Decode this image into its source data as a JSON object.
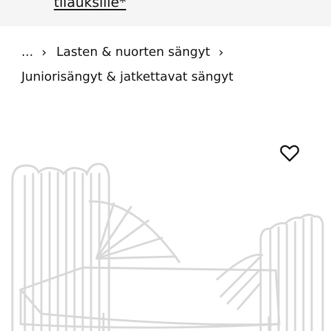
{
  "banner": {
    "link_text": "tilauksille*"
  },
  "breadcrumb": {
    "ellipsis": "...",
    "parent": "Lasten & nuorten sängyt",
    "current": "Juniorisängyt & jatkettavat sängyt"
  },
  "icons": {
    "separator": "chevron-right-icon",
    "favourite": "heart-icon"
  },
  "colors": {
    "banner_bg": "#f5f5f5",
    "text": "#111111",
    "product": "#ffffff"
  }
}
